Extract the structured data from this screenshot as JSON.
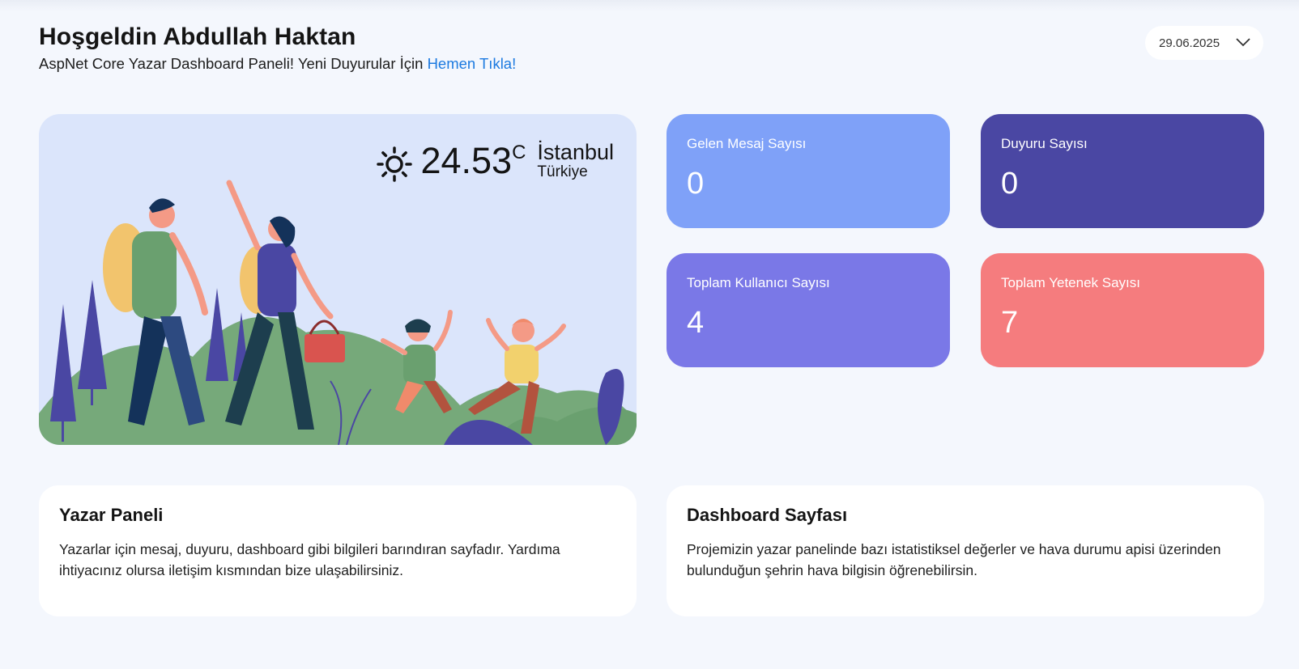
{
  "header": {
    "title": "Hoşgeldin Abdullah Haktan",
    "subtitle": "AspNet Core Yazar Dashboard Paneli! Yeni Duyurular İçin",
    "subtitle_link": "Hemen Tıkla!"
  },
  "date_picker": {
    "value": "29.06.2025",
    "icon": "chevron-down-icon"
  },
  "weather": {
    "temperature": "24.53",
    "unit": "C",
    "city": "İstanbul",
    "country": "Türkiye",
    "icon": "sun-icon"
  },
  "stats": [
    {
      "label": "Gelen Mesaj Sayısı",
      "value": "0",
      "color": "#7fa1f8"
    },
    {
      "label": "Duyuru Sayısı",
      "value": "0",
      "color": "#4a47a3"
    },
    {
      "label": "Toplam Kullanıcı Sayısı",
      "value": "4",
      "color": "#7a78e7"
    },
    {
      "label": "Toplam Yetenek Sayısı",
      "value": "7",
      "color": "#f57c7e"
    }
  ],
  "info_cards": [
    {
      "title": "Yazar Paneli",
      "text": "Yazarlar için mesaj, duyuru, dashboard gibi bilgileri barındıran sayfadır. Yardıma ihtiyacınız olursa iletişim kısmından bize ulaşabilirsiniz."
    },
    {
      "title": "Dashboard Sayfası",
      "text": "Projemizin yazar panelinde bazı istatistiksel değerler ve hava durumu apisi üzerinden bulunduğun şehrin hava bilgisin öğrenebilirsin."
    }
  ]
}
